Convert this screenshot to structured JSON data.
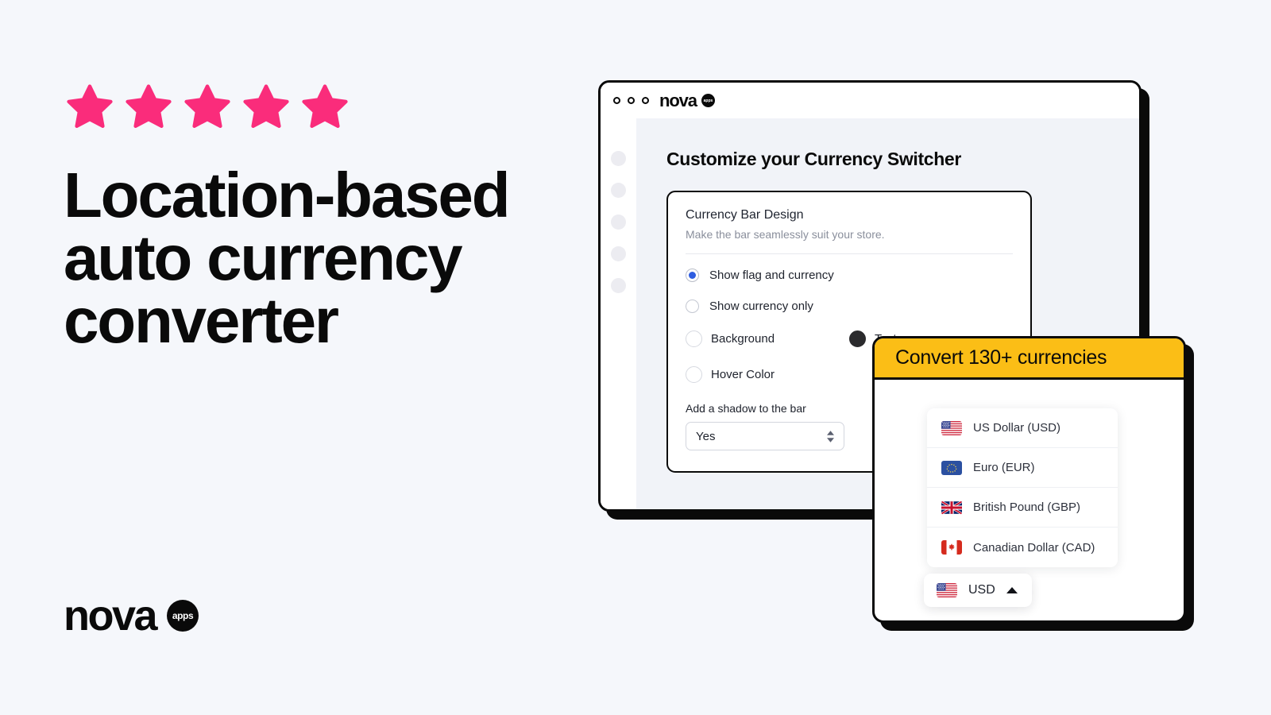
{
  "page": {
    "background_color": "#f5f7fb",
    "star_color": "#fa2c7b",
    "accent_yellow": "#fbbe16",
    "ink": "#0a0a0a"
  },
  "hero": {
    "rating_stars": 5,
    "headline_line1": "Location-based",
    "headline_line2": "auto currency",
    "headline_line3": "converter"
  },
  "brand": {
    "wordmark": "nova",
    "badge_text": "apps"
  },
  "browser": {
    "topbar": {
      "wordmark": "nova",
      "badge_text": "apps",
      "dots": [
        "window-dot",
        "window-dot",
        "window-dot"
      ]
    },
    "sidebar": {
      "items": [
        {
          "name": "nav-bubble-1"
        },
        {
          "name": "nav-bubble-2"
        },
        {
          "name": "nav-bubble-3"
        },
        {
          "name": "nav-bubble-4"
        },
        {
          "name": "nav-bubble-5"
        }
      ]
    },
    "main": {
      "page_title": "Customize your Currency Switcher",
      "card": {
        "title": "Currency Bar Design",
        "subtitle": "Make the bar seamlessly suit your store.",
        "radios": [
          {
            "label": "Show flag and currency",
            "selected": true
          },
          {
            "label": "Show currency only",
            "selected": false
          }
        ],
        "swatches": [
          {
            "label": "Background",
            "color": "#ffffff",
            "filled": false
          },
          {
            "label": "Text",
            "color": "#2b2b2d",
            "filled": true
          },
          {
            "label": "Hover Color",
            "color": "#ffffff",
            "filled": false
          }
        ],
        "shadow_field": {
          "label": "Add a shadow to the bar",
          "value": "Yes"
        }
      }
    }
  },
  "currency_panel": {
    "header_title": "Convert 130+ currencies",
    "currencies": [
      {
        "flag": "us-flag-icon",
        "name": "US Dollar (USD)"
      },
      {
        "flag": "eu-flag-icon",
        "name": "Euro (EUR)"
      },
      {
        "flag": "gb-flag-icon",
        "name": "British Pound (GBP)"
      },
      {
        "flag": "ca-flag-icon",
        "name": "Canadian Dollar (CAD)"
      }
    ],
    "selector": {
      "flag": "us-flag-icon",
      "code": "USD",
      "caret": "caret-up-icon"
    }
  }
}
